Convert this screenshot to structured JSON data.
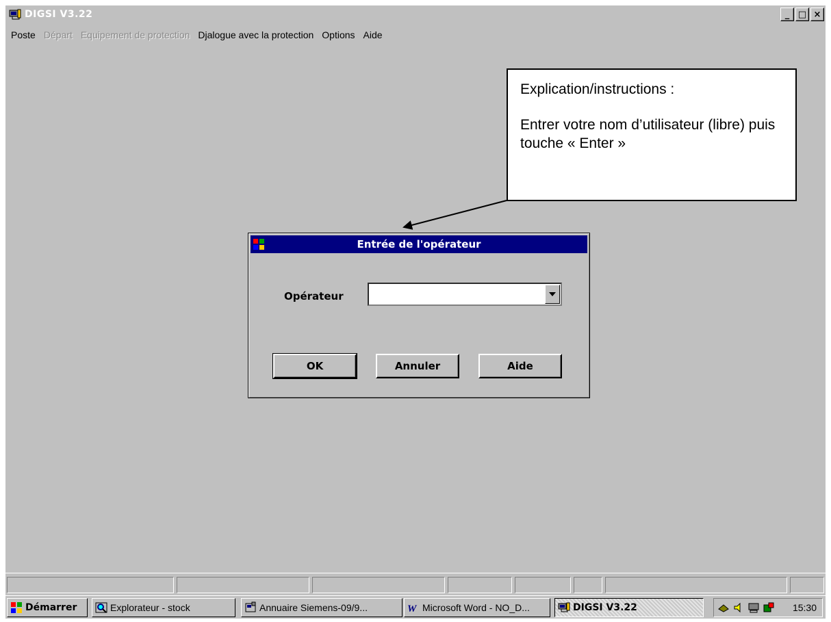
{
  "window": {
    "title": "DIGSI  V3.22",
    "controls": [
      "_",
      "□",
      "×"
    ]
  },
  "menu": [
    {
      "label": "Poste",
      "enabled": true
    },
    {
      "label": "Départ",
      "enabled": false
    },
    {
      "label": "Equipement de protection",
      "enabled": false
    },
    {
      "label": "Djalogue avec la protection",
      "enabled": true
    },
    {
      "label": "Options",
      "enabled": true
    },
    {
      "label": "Aide",
      "enabled": true
    }
  ],
  "annotation": {
    "line1": "Explication/instructions :",
    "line2": "Entrer votre nom d’utilisateur (libre) puis touche « Enter »"
  },
  "dialog": {
    "title": "Entrée de l'opérateur",
    "operator_label": "Opérateur",
    "operator_value": "",
    "buttons": {
      "ok": "OK",
      "cancel": "Annuler",
      "help": "Aide"
    }
  },
  "taskbar": {
    "start": "Démarrer",
    "tasks": [
      {
        "label": "Explorateur - stock",
        "icon": "explorer-icon"
      },
      {
        "label": "Annuaire Siemens-09/9...",
        "icon": "phonebook-icon"
      },
      {
        "label": "Microsoft Word - NO_D...",
        "icon": "word-icon"
      },
      {
        "label": "DIGSI  V3.22",
        "icon": "digsi-icon",
        "active": true
      }
    ],
    "clock": "15:30"
  },
  "colors": {
    "desktop": "#c0c0c0",
    "dialog_title": "#000080",
    "window_title_text": "#ffffff"
  }
}
